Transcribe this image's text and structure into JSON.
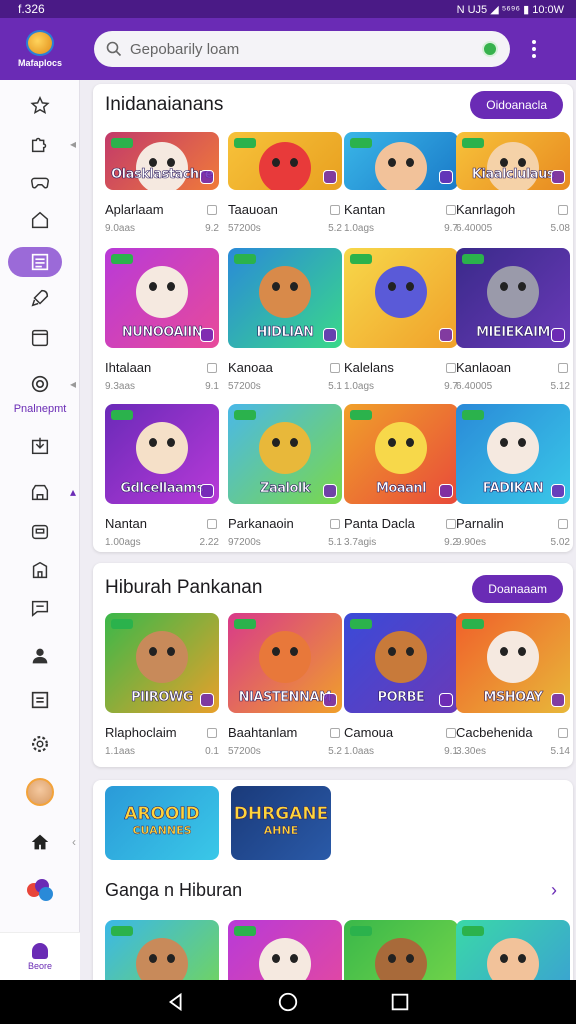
{
  "status": {
    "time": "f.326",
    "right": "N UJ5 ◢ ⁵⁶⁹⁶ ▮ 10:0W"
  },
  "app": {
    "logo_text": "Mafaplocs",
    "search_placeholder": "Gepobarily loam"
  },
  "sidebar": {
    "label_1": "Pnalnepmt",
    "bottom_label": "Beore"
  },
  "section1": {
    "title": "Inidanaianans",
    "button": "Oidoanacla",
    "rows": [
      [
        {
          "thumb_title": "Olasklastachre",
          "name": "Aplarlaam",
          "meta_left": "9.0aas",
          "meta_right": "9.2",
          "c1": "#c23a6a",
          "c2": "#f07a3a",
          "char": "#f5e9e0"
        },
        {
          "thumb_title": "",
          "name": "Taauoan",
          "meta_left": "57200s",
          "meta_right": "5.2",
          "c1": "#f7c23a",
          "c2": "#e8a020",
          "char": "#e83a3a"
        },
        {
          "thumb_title": "",
          "name": "Kantan",
          "meta_left": "1.0ags",
          "meta_right": "9.7",
          "c1": "#3ab6e8",
          "c2": "#1a7ac8",
          "char": "#f2c29a"
        },
        {
          "thumb_title": "Kiaalclulaus",
          "name": "Kanrlagoh",
          "meta_left": "6.40005",
          "meta_right": "5.08",
          "c1": "#f7c23a",
          "c2": "#e88a20",
          "char": "#f5d2a8"
        }
      ],
      [
        {
          "thumb_title": "NUNOOAIIN",
          "name": "Ihtalaan",
          "meta_left": "9.3aas",
          "meta_right": "9.1",
          "c1": "#b83ad8",
          "c2": "#e84a9a",
          "char": "#f5e9e0"
        },
        {
          "thumb_title": "HIDLIAN",
          "name": "Kanoaa",
          "meta_left": "57200s",
          "meta_right": "5.1",
          "c1": "#2a8ad8",
          "c2": "#3ad88a",
          "char": "#d88a4a"
        },
        {
          "thumb_title": "",
          "name": "Kalelans",
          "meta_left": "1.0ags",
          "meta_right": "9.7",
          "c1": "#f7d84a",
          "c2": "#f0a02a",
          "char": "#5a5ad8"
        },
        {
          "thumb_title": "MIEIEKAIM",
          "name": "Kanlaoan",
          "meta_left": "6.40005",
          "meta_right": "5.12",
          "c1": "#3a2a8a",
          "c2": "#6a3ab8",
          "char": "#9a9aaa"
        }
      ],
      [
        {
          "thumb_title": "Gdlcellaams",
          "name": "Nantan",
          "meta_left": "1.00ags",
          "meta_right": "2.22",
          "c1": "#6a2ab8",
          "c2": "#b83ad8",
          "char": "#f5e0c8"
        },
        {
          "thumb_title": "Zaalolk",
          "name": "Parkanaoin",
          "meta_left": "97200s",
          "meta_right": "5.1",
          "c1": "#4ab8e8",
          "c2": "#7ad84a",
          "char": "#e8b83a"
        },
        {
          "thumb_title": "Moaanl",
          "name": "Panta Dacla",
          "meta_left": "3.7agis",
          "meta_right": "9.2",
          "c1": "#f0a02a",
          "c2": "#e84a3a",
          "char": "#f7d84a"
        },
        {
          "thumb_title": "FADIKAN",
          "name": "Parnalin",
          "meta_left": "9.90es",
          "meta_right": "5.02",
          "c1": "#2a8ad8",
          "c2": "#3ac8e8",
          "char": "#f5e9e0"
        }
      ]
    ]
  },
  "section2": {
    "title": "Hiburah Pankanan",
    "button": "Doanaaam",
    "items": [
      {
        "thumb_title": "PIIROWG",
        "name": "Rlaphoclaim",
        "meta_left": "1.1aas",
        "meta_right": "0.1",
        "c1": "#3ab84a",
        "c2": "#e8a02a",
        "char": "#c88a5a"
      },
      {
        "thumb_title": "NIASTENNAM",
        "name": "Baahtanlam",
        "meta_left": "57200s",
        "meta_right": "5.2",
        "c1": "#d83a8a",
        "c2": "#f0a02a",
        "char": "#e8783a"
      },
      {
        "thumb_title": "PORBE",
        "name": "Camoua",
        "meta_left": "1.0aas",
        "meta_right": "9.1",
        "c1": "#3a4ad8",
        "c2": "#6a3ab8",
        "char": "#c87a3a"
      },
      {
        "thumb_title": "MSHOAY",
        "name": "Cacbehenida",
        "meta_left": "3.30es",
        "meta_right": "5.14",
        "c1": "#f0602a",
        "c2": "#e8b83a",
        "char": "#f5e9e0"
      }
    ]
  },
  "section3": {
    "banners": [
      {
        "title": "AROOID",
        "subtitle": "CUANNES",
        "c1": "#2a9ad8",
        "c2": "#3ac8e8"
      },
      {
        "title": "DHRGANE",
        "subtitle": "AHNE",
        "c1": "#1a3a7a",
        "c2": "#2a5aa8"
      }
    ],
    "title": "Ganga n Hiburan",
    "thumbs": [
      {
        "c1": "#3ab8e8",
        "c2": "#7ad84a",
        "char": "#c88a5a"
      },
      {
        "c1": "#b83ad8",
        "c2": "#e84a9a",
        "char": "#f5e9e0"
      },
      {
        "c1": "#3ab84a",
        "c2": "#7ad84a",
        "char": "#a86a3a"
      },
      {
        "c1": "#3ad8a8",
        "c2": "#3a9ad8",
        "char": "#f2c29a"
      }
    ]
  },
  "colors": {
    "brand": "#6a2bb5",
    "statusbar": "#4a1a86"
  }
}
